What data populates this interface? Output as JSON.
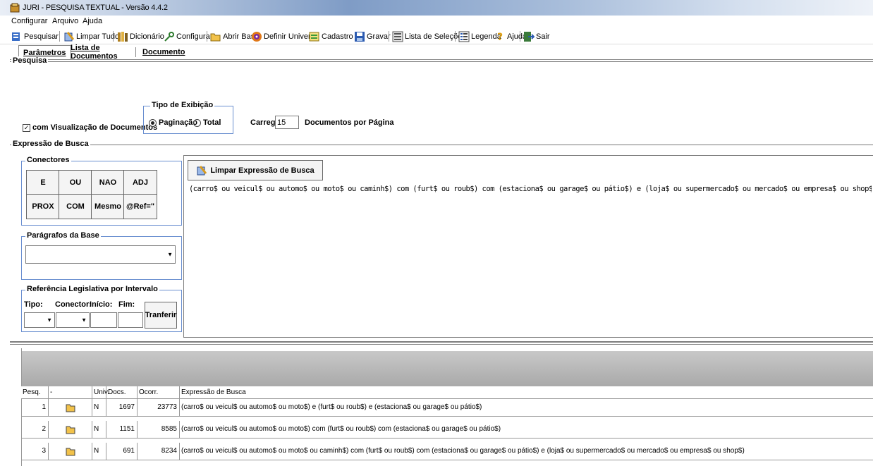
{
  "window": {
    "title": "JURI - PESQUISA TEXTUAL - Versão 4.4.2"
  },
  "menu": [
    "Configurar",
    "Arquivo",
    "Ajuda"
  ],
  "toolbar": {
    "pesquisar": "Pesquisar",
    "limpar_tudo": "Limpar Tudo",
    "dicionario": "Dicionário",
    "configurar": "Configurar",
    "abrir_base": "Abrir Base",
    "definir_universo": "Definir Universo",
    "cadastro": "Cadastro",
    "gravar": "Gravar",
    "lista_selecoes": "Lista de Seleções",
    "legenda": "Legenda",
    "ajuda": "Ajuda",
    "sair": "Sair"
  },
  "tabs": [
    "Parâmetros",
    "Lista de Documentos",
    "Documento"
  ],
  "pesquisa": {
    "label": "Pesquisa",
    "visualizacao_label": "com Visualização de Documentos",
    "visualizacao_checked": true,
    "tipo_exibicao_label": "Tipo de Exibição",
    "paginacao_label": "Paginação",
    "total_label": "Total",
    "selected": "Paginação",
    "carregar_label": "Carregar",
    "carregar_value": "15",
    "documentos_label": "Documentos por Página"
  },
  "expressao": {
    "label": "Expressão de Busca",
    "conectores_label": "Conectores",
    "conectores": [
      "E",
      "OU",
      "NAO",
      "ADJ",
      "PROX",
      "COM",
      "Mesmo",
      "@Ref=\""
    ],
    "paragrafos_label": "Parágrafos da Base",
    "referencia_label": "Referência Legislativa por Intervalo",
    "tipo_label": "Tipo:",
    "conector_label": "Conector:",
    "inicio_label": "Início:",
    "fim_label": "Fim:",
    "transferir_label": "Tranferir",
    "limpar_button": "Limpar Expressão de Busca",
    "text": "(carro$ ou veicul$ ou automo$ ou moto$ ou caminh$) com (furt$ ou roub$) com (estaciona$ ou garage$ ou pátio$) e (loja$ ou supermercado$ ou mercado$ ou empresa$ ou shop$)"
  },
  "history": {
    "headers": [
      "Pesq.",
      "-",
      "Univ.",
      "Docs.",
      "Ocorr.",
      "Expressão de Busca"
    ],
    "rows": [
      {
        "pesq": "1",
        "univ": "N",
        "docs": "1697",
        "ocorr": "23773",
        "expr": "(carro$ ou veicul$ ou automo$ ou moto$) e (furt$ ou roub$) e (estaciona$ ou garage$ ou pátio$)"
      },
      {
        "pesq": "2",
        "univ": "N",
        "docs": "1151",
        "ocorr": "8585",
        "expr": "(carro$ ou veicul$ ou automo$ ou moto$) com (furt$ ou roub$) com (estaciona$ ou garage$ ou pátio$)"
      },
      {
        "pesq": "3",
        "univ": "N",
        "docs": "691",
        "ocorr": "8234",
        "expr": "(carro$ ou veicul$ ou automo$ ou moto$ ou caminh$) com (furt$ ou roub$) com (estaciona$ ou garage$ ou pátio$) e (loja$ ou supermercado$ ou mercado$ ou empresa$ ou shop$)"
      }
    ]
  }
}
